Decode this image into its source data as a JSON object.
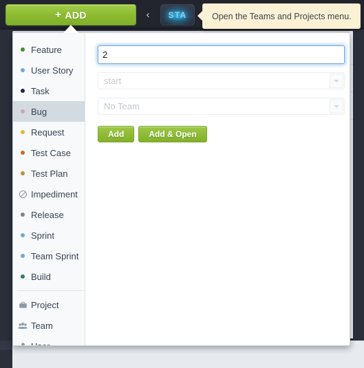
{
  "topbar": {
    "add_button_label": "ADD",
    "add_button_plus": "+",
    "collapse_icon_char": "‹",
    "sta_button_label": "STA"
  },
  "tooltip": {
    "text": "Open the Teams and Projects menu."
  },
  "add_panel": {
    "type_groups": [
      {
        "items": [
          {
            "label": "Feature",
            "marker": "bullet",
            "icon": "bullet-dot-icon",
            "color": "#3f8f2f",
            "selected": false
          },
          {
            "label": "User Story",
            "marker": "bullet",
            "icon": "bullet-dot-icon",
            "color": "#6fa8dc",
            "selected": false
          },
          {
            "label": "Task",
            "marker": "bullet",
            "icon": "bullet-dot-icon",
            "color": "#26215e",
            "selected": false
          },
          {
            "label": "Bug",
            "marker": "bullet",
            "icon": "bullet-dot-icon",
            "color": "#c9a8b0",
            "selected": true
          },
          {
            "label": "Request",
            "marker": "bullet",
            "icon": "bullet-dot-icon",
            "color": "#e8b828",
            "selected": false
          },
          {
            "label": "Test Case",
            "marker": "bullet",
            "icon": "bullet-dot-icon",
            "color": "#c9711c",
            "selected": false
          },
          {
            "label": "Test Plan",
            "marker": "bullet",
            "icon": "bullet-dot-icon",
            "color": "#b99427",
            "selected": false
          },
          {
            "label": "Impediment",
            "marker": "glyph",
            "icon": "prohibition-icon",
            "color": "#8f98a6",
            "selected": false
          },
          {
            "label": "Release",
            "marker": "bullet",
            "icon": "bullet-dot-icon",
            "color": "#7d8490",
            "selected": false
          },
          {
            "label": "Sprint",
            "marker": "bullet",
            "icon": "bullet-dot-icon",
            "color": "#70a8d8",
            "selected": false
          },
          {
            "label": "Team Sprint",
            "marker": "bullet",
            "icon": "bullet-dot-icon",
            "color": "#70a8d8",
            "selected": false
          },
          {
            "label": "Build",
            "marker": "bullet",
            "icon": "bullet-dot-icon",
            "color": "#2e7d6f",
            "selected": false
          }
        ]
      },
      {
        "items": [
          {
            "label": "Project",
            "marker": "glyph",
            "icon": "briefcase-icon",
            "color": "#8f98a6",
            "selected": false
          },
          {
            "label": "Team",
            "marker": "glyph",
            "icon": "group-icon",
            "color": "#8f98a6",
            "selected": false
          },
          {
            "label": "User",
            "marker": "glyph",
            "icon": "person-icon",
            "color": "#8f98a6",
            "selected": false
          }
        ]
      }
    ],
    "form": {
      "title_value": "2",
      "title_placeholder": "",
      "start_select_value": "start",
      "team_select_value": "No Team",
      "add_label": "Add",
      "add_open_label": "Add & Open"
    }
  },
  "colors": {
    "accent_green": "#8cbb32",
    "chrome_dark": "#23252e",
    "tooltip_bg": "#fbf2d5",
    "selected_row": "#d3dae0",
    "focus_blue": "#6fa8d4"
  }
}
